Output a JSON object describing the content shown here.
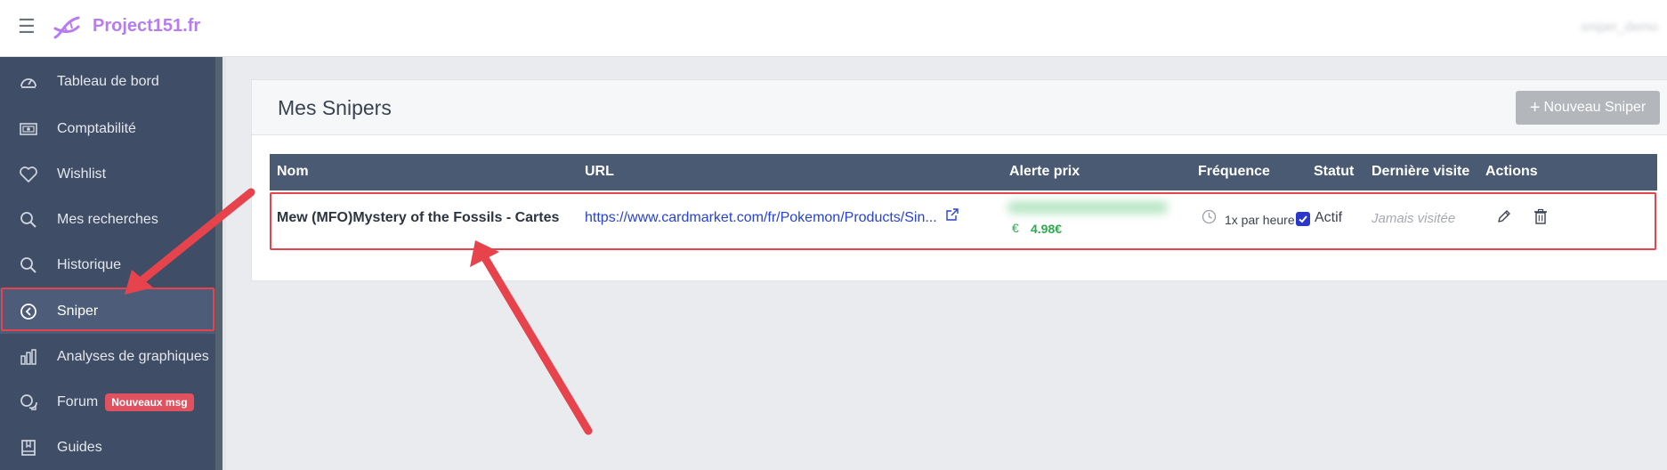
{
  "app": {
    "brand": "Project151.fr",
    "user_name": "sniper_demo",
    "menu_icon": "hamburger-icon",
    "logo_icon": "dna-logo-icon"
  },
  "sidebar": {
    "items": [
      {
        "label": "Tableau de bord",
        "icon": "dashboard-gauge-icon"
      },
      {
        "label": "Comptabilité",
        "icon": "accounting-cash-icon"
      },
      {
        "label": "Wishlist",
        "icon": "heart-icon"
      },
      {
        "label": "Mes recherches",
        "icon": "search-icon"
      },
      {
        "label": "Historique",
        "icon": "history-search-icon"
      },
      {
        "label": "Sniper",
        "icon": "sniper-clock-icon",
        "active": true
      },
      {
        "label": "Analyses de graphiques",
        "icon": "bar-chart-icon"
      },
      {
        "label": "Forum",
        "icon": "forum-bubbles-icon",
        "badge": "Nouveaux msg"
      },
      {
        "label": "Guides",
        "icon": "book-icon"
      }
    ]
  },
  "page": {
    "title": "Mes Snipers",
    "new_button": "Nouveau Sniper"
  },
  "table": {
    "headers": [
      "Nom",
      "URL",
      "Alerte prix",
      "Fréquence",
      "Statut",
      "Dernière visite",
      "Actions"
    ],
    "rows": [
      {
        "name": "Mew (MFO)Mystery of the Fossils - Cartes",
        "url": "https://www.cardmarket.com/fr/Pokemon/Products/Sin...",
        "price_currency": "€",
        "price": "4.98€",
        "frequency": "1x par heure",
        "status": "Actif",
        "status_checked": true,
        "last_visit": "Jamais visitée"
      }
    ]
  },
  "colors": {
    "sidebar_bg": "#3f4d66",
    "brand": "#b87cf2",
    "table_header": "#4a5a72",
    "link": "#2742d4",
    "price": "#2eaa4f",
    "annotation": "#e7434c"
  }
}
